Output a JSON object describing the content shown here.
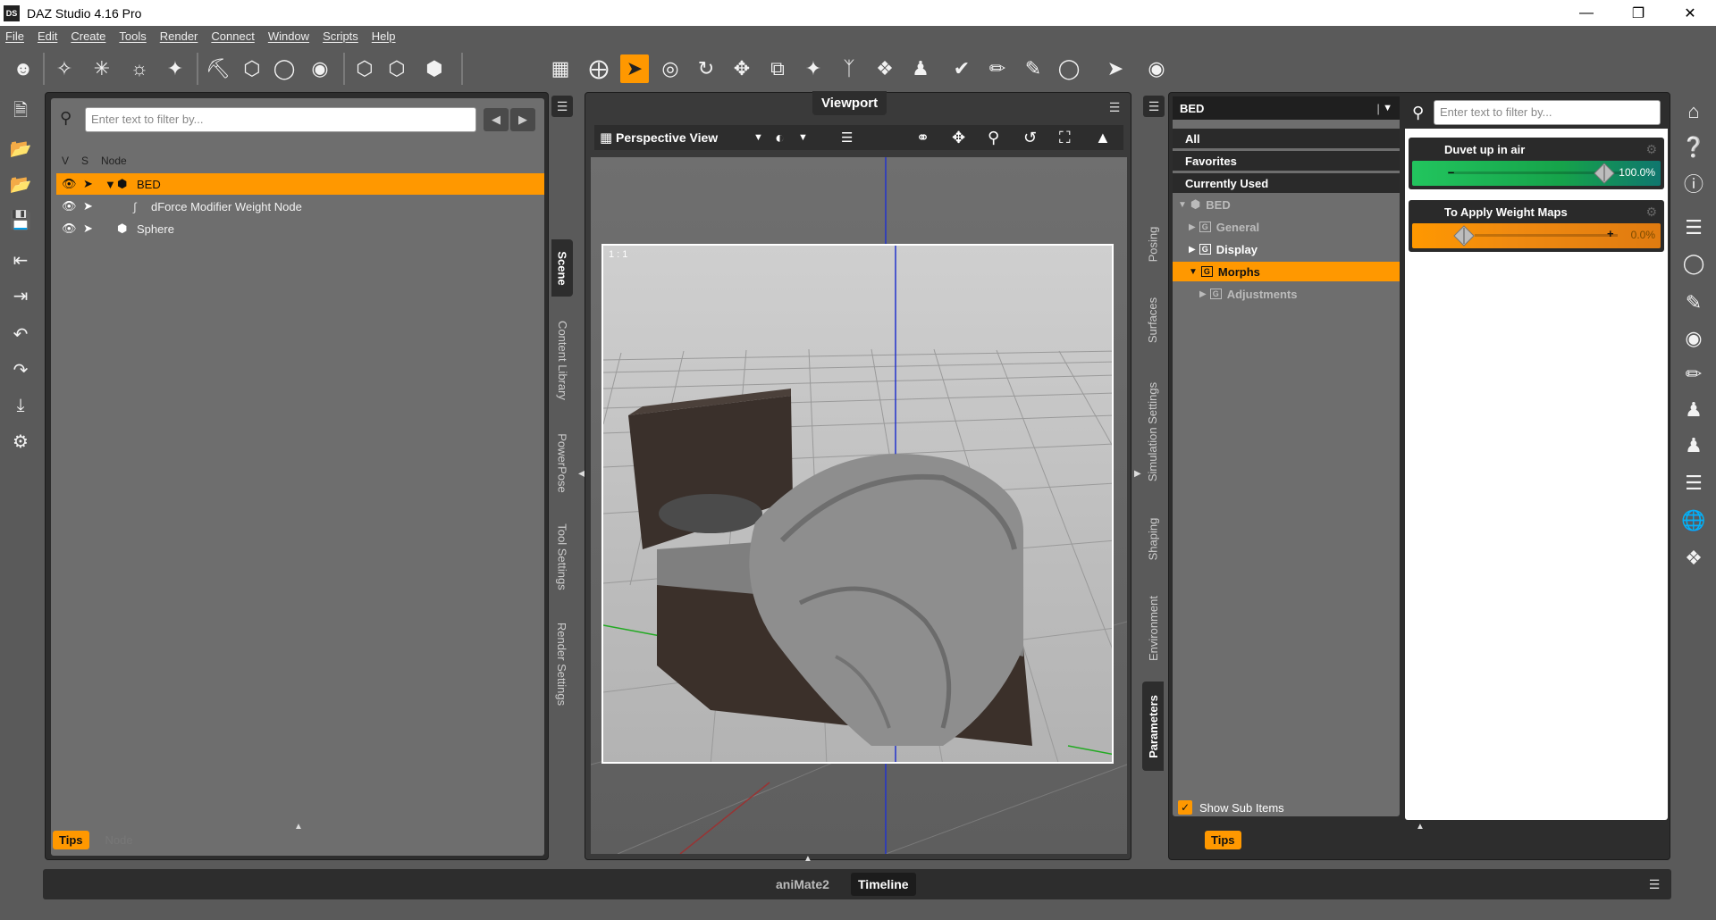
{
  "window": {
    "title": "DAZ Studio 4.16 Pro",
    "app_icon": "DS",
    "controls": [
      "minimize-icon",
      "restore-icon",
      "close-icon"
    ]
  },
  "menu": [
    "File",
    "Edit",
    "Create",
    "Tools",
    "Render",
    "Connect",
    "Window",
    "Scripts",
    "Help"
  ],
  "toolbar": {
    "active_tool": "node-selection-tool"
  },
  "scene": {
    "search_placeholder": "Enter text to filter by...",
    "columns": {
      "v": "V",
      "s": "S",
      "node": "Node"
    },
    "rows": [
      {
        "label": "BED",
        "selected": true
      },
      {
        "label": "dForce Modifier Weight Node",
        "selected": false
      },
      {
        "label": "Sphere",
        "selected": false
      }
    ],
    "bottom_tabs": {
      "tips": "Tips",
      "node": "Node"
    }
  },
  "left_vtabs": [
    "Scene",
    "Content Library",
    "PowerPose",
    "Tool Settings",
    "Render Settings"
  ],
  "viewport": {
    "tab_title": "Viewport",
    "view_name": "Perspective View",
    "frame_ratio": "1 : 1"
  },
  "right_vtabs": [
    "Posing",
    "Surfaces",
    "Simulation Settings",
    "Shaping",
    "Environment",
    "Parameters"
  ],
  "parameters": {
    "node": "BED",
    "search_placeholder": "Enter text to filter by...",
    "filters": [
      "All",
      "Favorites",
      "Currently Used"
    ],
    "tree": [
      {
        "label": "BED",
        "level": 0
      },
      {
        "label": "General",
        "level": 1
      },
      {
        "label": "Display",
        "level": 1
      },
      {
        "label": "Morphs",
        "level": 1,
        "selected": true
      },
      {
        "label": "Adjustments",
        "level": 2
      }
    ],
    "show_sub_items": "Show Sub Items",
    "sliders": [
      {
        "label": "Duvet up in air",
        "value": "100.0%",
        "fraction": 1.0,
        "color": "#22c55e"
      },
      {
        "label": "To Apply Weight Maps",
        "value": "0.0%",
        "fraction": 0.0,
        "color": "#f08a10"
      }
    ],
    "bottom_tab": "Tips"
  },
  "timeline": {
    "tabs": [
      "aniMate2",
      "Timeline"
    ],
    "active": "Timeline"
  },
  "colors": {
    "accent": "#ff9800",
    "panel_bg": "#2d2d2d",
    "app_bg": "#5a5a5a"
  }
}
